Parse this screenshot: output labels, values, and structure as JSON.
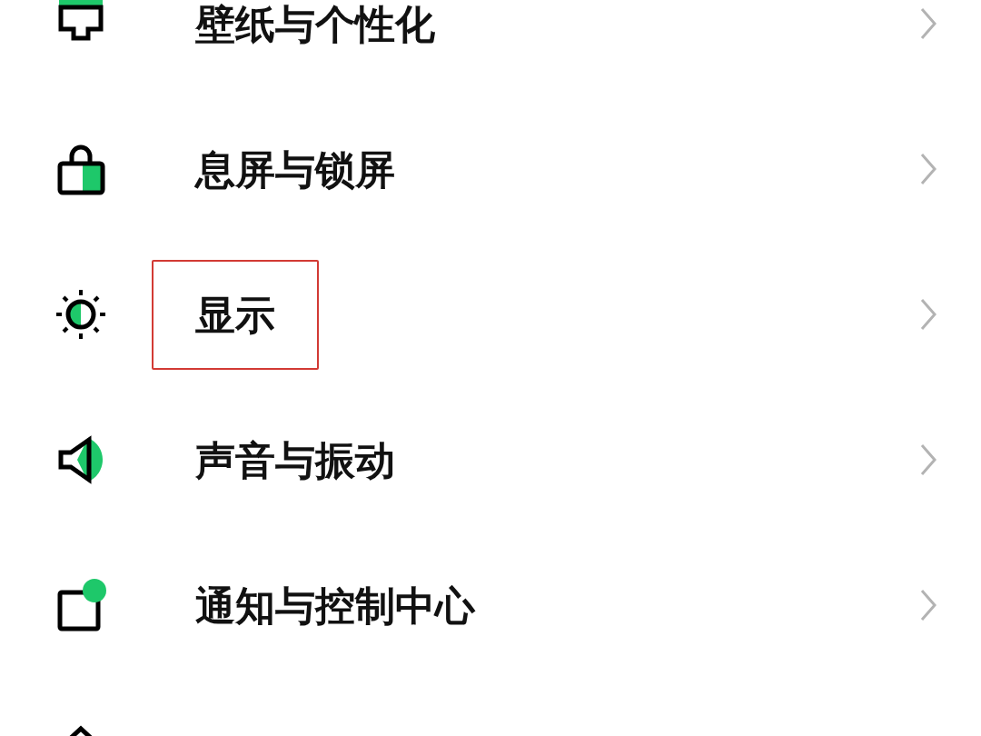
{
  "settings_list": [
    {
      "kind": "wallpaper",
      "label": "壁纸与个性化",
      "highlighted": false
    },
    {
      "kind": "lock",
      "label": "息屏与锁屏",
      "highlighted": false
    },
    {
      "kind": "brightness",
      "label": "显示",
      "highlighted": true
    },
    {
      "kind": "sound",
      "label": "声音与振动",
      "highlighted": false
    },
    {
      "kind": "notification",
      "label": "通知与控制中心",
      "highlighted": false
    },
    {
      "kind": "home"
    }
  ]
}
